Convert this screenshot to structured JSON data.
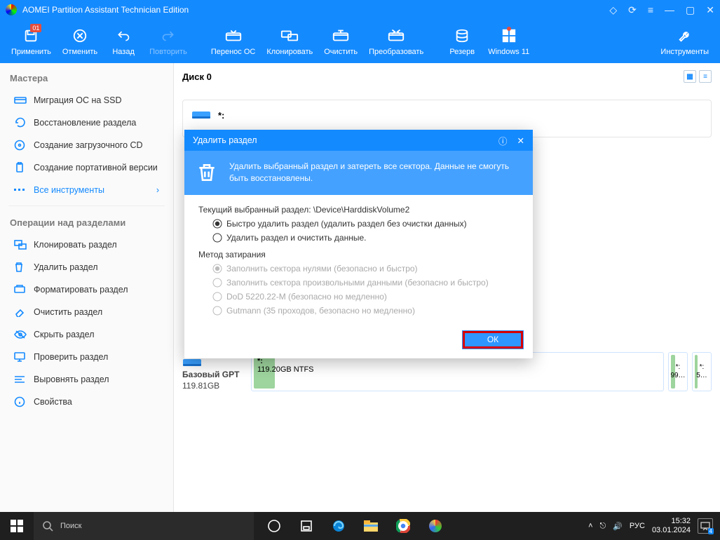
{
  "app": {
    "title": "AOMEI Partition Assistant Technician Edition"
  },
  "toolbar": {
    "apply": "Применить",
    "apply_badge": "01",
    "undo": "Отменить",
    "back": "Назад",
    "redo": "Повторить",
    "migrate": "Перенос ОС",
    "clone": "Клонировать",
    "wipe": "Очистить",
    "convert": "Преобразовать",
    "backup": "Резерв",
    "win11": "Windows 11",
    "tools": "Инструменты"
  },
  "sidebar": {
    "masters_hdr": "Мастера",
    "migrate_ssd": "Миграция ОС на SSD",
    "recover": "Восстановление раздела",
    "boot_cd": "Создание загрузочного CD",
    "portable": "Создание портативной версии",
    "all_tools": "Все инструменты",
    "ops_hdr": "Операции над разделами",
    "clone_part": "Клонировать раздел",
    "delete_part": "Удалить раздел",
    "format_part": "Форматировать раздел",
    "wipe_part": "Очистить раздел",
    "hide_part": "Скрыть раздел",
    "check_part": "Проверить раздел",
    "align_part": "Выровнять раздел",
    "props": "Свойства"
  },
  "main": {
    "disk_header": "Диск 0",
    "disk_star_label": "*:",
    "disk_type": "Базовый GPT",
    "disk_size": "119.81GB",
    "part_label": "*:",
    "part_info": "119.20GB NTFS",
    "mini1": "*:",
    "mini1b": "99…",
    "mini2": "*:",
    "mini2b": "5…"
  },
  "dialog": {
    "title": "Удалить раздел",
    "banner": "Удалить выбранный раздел и затереть все сектора. Данные не смогуть быть восстановлены.",
    "current": "Текущий выбранный раздел:  \\Device\\HarddiskVolume2",
    "opt1": "Быстро удалить раздел (удалить раздел без очистки данных)",
    "opt2": "Удалить раздел и очистить данные.",
    "method_hdr": "Метод затирания",
    "m1": "Заполнить сектора нулями (безопасно и быстро)",
    "m2": "Заполнить сектора произвольными данными (безопасно и быстро)",
    "m3": "DoD 5220.22-M (безопасно но медленно)",
    "m4": "Gutmann (35 проходов, безопасно но медленно)",
    "ok": "ОК"
  },
  "taskbar": {
    "search": "Поиск",
    "lang": "РУС",
    "time": "15:32",
    "date": "03.01.2024",
    "notif_count": "4"
  }
}
